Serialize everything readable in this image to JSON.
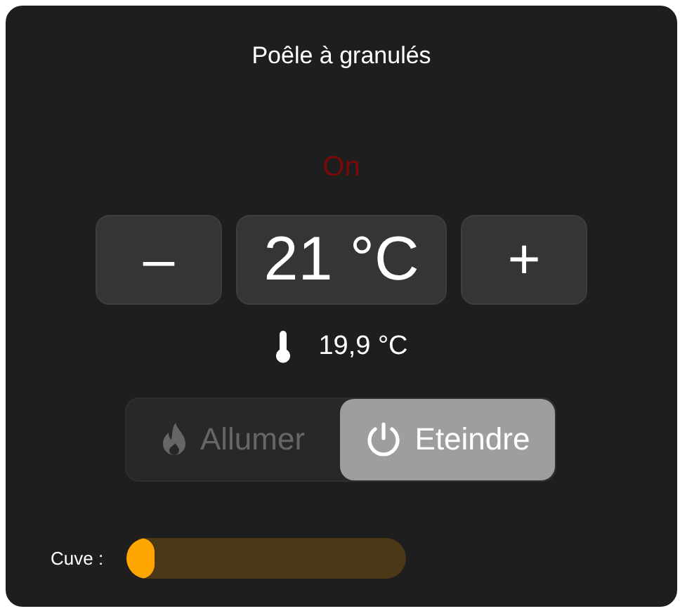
{
  "title": "Poêle à granulés",
  "status": "On",
  "setpoint": {
    "decrease": "–",
    "value": "21 °C",
    "increase": "+"
  },
  "current_temperature": "19,9 °C",
  "modes": [
    {
      "kind": "fire",
      "label": "Allumer",
      "selected": false
    },
    {
      "kind": "power",
      "label": "Eteindre",
      "selected": true
    }
  ],
  "tank": {
    "label": "Cuve :",
    "level": 0.1
  }
}
